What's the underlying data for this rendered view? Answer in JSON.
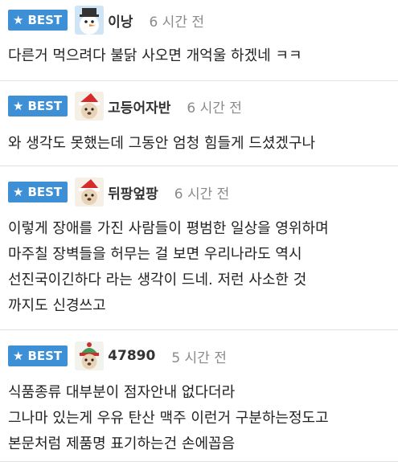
{
  "comments": [
    {
      "badge": "BEST",
      "avatar": "snowman-avatar",
      "nickname": "이낭",
      "time": "6 시간 전",
      "lines": [
        "다른거 먹으려다 불닭 사오면 개억울 하겠네 ㅋㅋ"
      ]
    },
    {
      "badge": "BEST",
      "avatar": "santa-dog-avatar",
      "nickname": "고등어자반",
      "time": "6 시간 전",
      "lines": [
        "와 생각도 못했는데 그동안 엄청 힘들게 드셨겠구나"
      ]
    },
    {
      "badge": "BEST",
      "avatar": "santa-dog-avatar",
      "nickname": "뒤팡엎팡",
      "time": "6 시간 전",
      "lines": [
        "이렇게 장애를 가진 사람들이 평범한 일상을 영위하며",
        "마주칠 장벽들을 허무는 걸 보면 우리나라도 역시",
        "선진국이긴하다 라는 생각이 드네. 저런 사소한 것",
        "까지도 신경쓰고"
      ]
    },
    {
      "badge": "BEST",
      "avatar": "knit-hat-dog-avatar",
      "nickname": "47890",
      "time": "5 시간 전",
      "lines": [
        "식품종류 대부분이 점자안내 없다더라",
        "그나마 있는게 우유 탄산 맥주 이런거 구분하는정도고",
        "본문처럼 제품명 표기하는건 손에꼽음"
      ]
    }
  ],
  "colors": {
    "badge": "#3d8fd6",
    "time": "#8a8a8a",
    "divider": "#e2e2e2"
  }
}
